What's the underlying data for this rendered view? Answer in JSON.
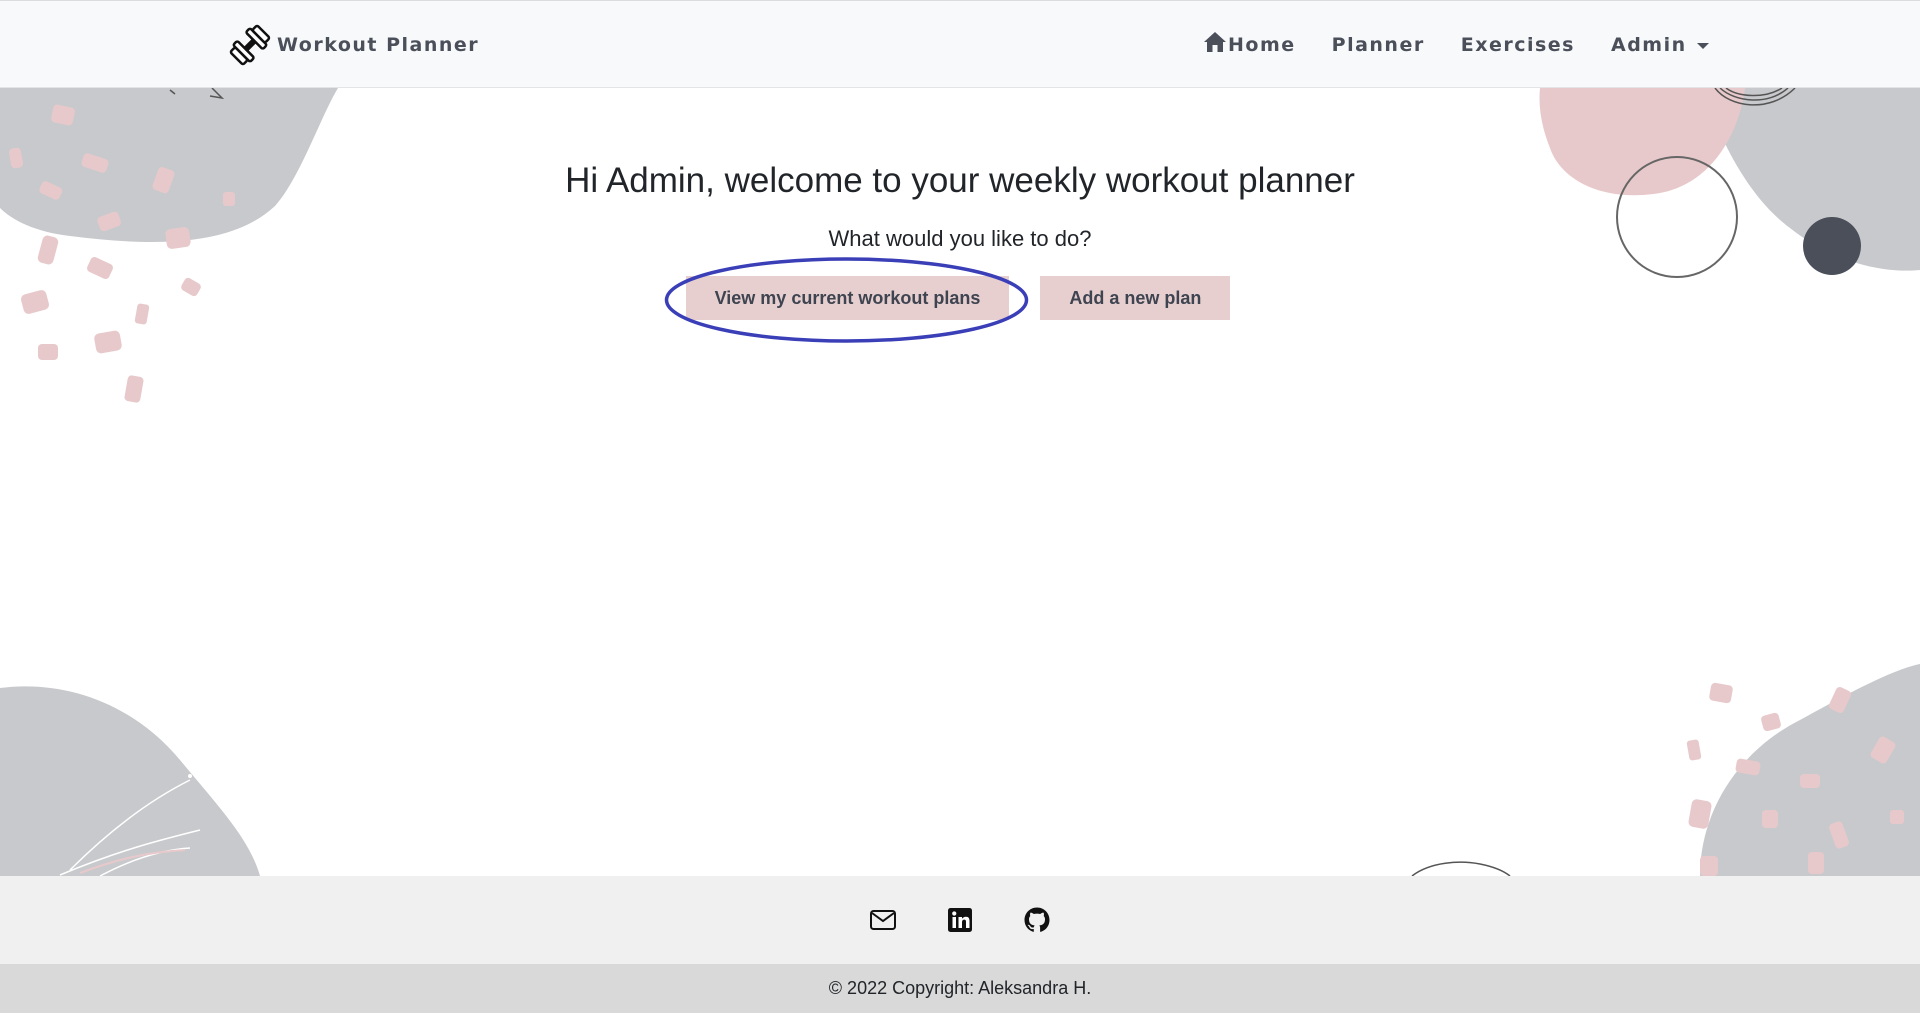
{
  "navbar": {
    "brand": {
      "name": "Workout Planner",
      "icon": "dumbbell-icon"
    },
    "items": [
      {
        "label": "Home",
        "icon": "home-icon"
      },
      {
        "label": "Planner"
      },
      {
        "label": "Exercises"
      },
      {
        "label": "Admin",
        "icon": "caret-down-icon"
      }
    ]
  },
  "main": {
    "heading": "Hi Admin, welcome to your weekly workout planner",
    "question": "What would you like to do?",
    "buttons": {
      "view_plans": "View my current workout plans",
      "add_plan": "Add a new plan"
    }
  },
  "footer": {
    "social": [
      {
        "icon": "envelope-icon"
      },
      {
        "icon": "linkedin-icon"
      },
      {
        "icon": "github-icon"
      }
    ],
    "copyright": "© 2022 Copyright: Aleksandra H."
  },
  "colors": {
    "navbar_bg": "#f8f9fa",
    "button_bg": "#e7cfd0",
    "annotation_ring": "#3a3fb8",
    "decor_gray": "#c8c9cc",
    "decor_pink": "#e8c9cb",
    "decor_dark": "#4a4f5a",
    "footer_social_bg": "#f0f0f0",
    "footer_copy_bg": "#d9d9d9"
  }
}
